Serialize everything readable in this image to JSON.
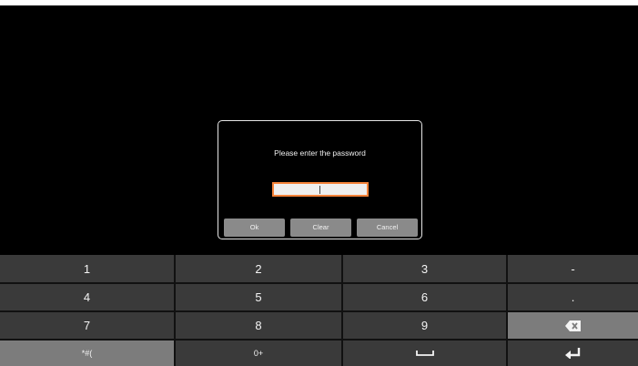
{
  "dialog": {
    "title": "Please enter the password",
    "password_value": "",
    "buttons": {
      "ok": "Ok",
      "clear": "Clear",
      "cancel": "Cancel"
    },
    "accent_color": "#f5833a"
  },
  "keyboard": {
    "rows": [
      [
        "1",
        "2",
        "3",
        "-"
      ],
      [
        "4",
        "5",
        "6",
        "."
      ],
      [
        "7",
        "8",
        "9",
        "backspace-icon"
      ],
      [
        "*#(",
        "0+",
        "space-icon",
        "enter-icon"
      ]
    ]
  }
}
